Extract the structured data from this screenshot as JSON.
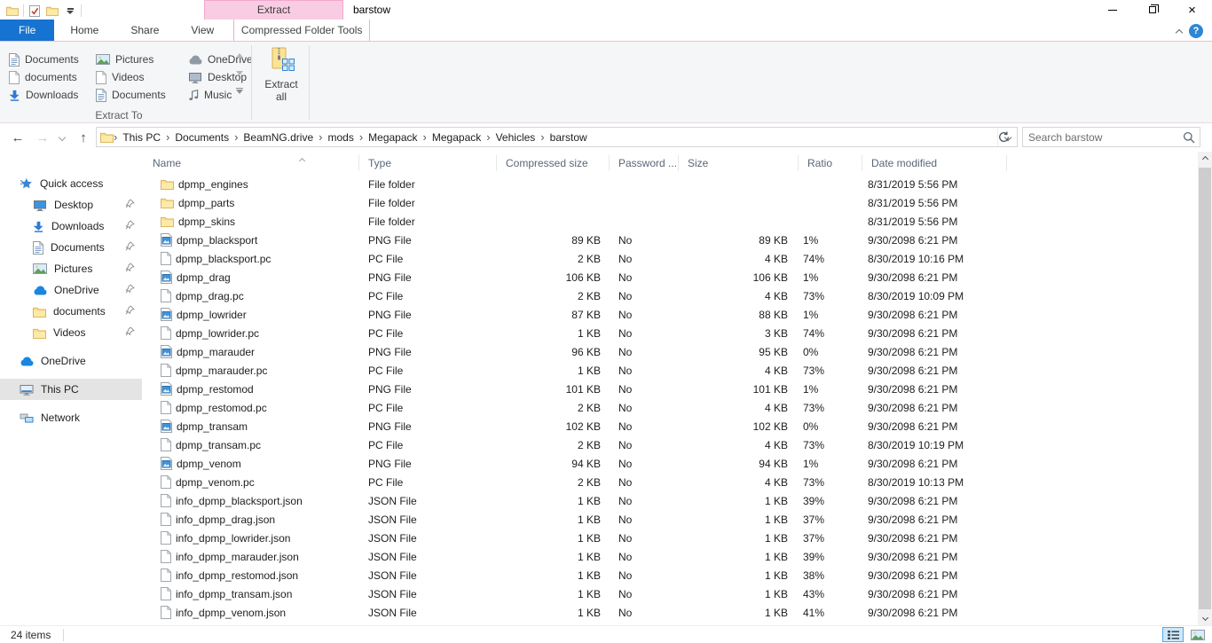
{
  "titlebar": {
    "contextual_header": "Extract",
    "window_title": "barstow",
    "qat_icons": [
      "explorer-folder-icon",
      "properties-check-icon",
      "new-folder-icon",
      "qat-customize-icon"
    ]
  },
  "tabs": [
    {
      "label": "File",
      "file": true
    },
    {
      "label": "Home"
    },
    {
      "label": "Share"
    },
    {
      "label": "View"
    },
    {
      "label": "Compressed Folder Tools",
      "contextual": true
    }
  ],
  "ribbon": {
    "group_label": "Extract To",
    "destinations": [
      {
        "label": "Documents",
        "icon": "document-icon"
      },
      {
        "label": "Pictures",
        "icon": "picture-icon"
      },
      {
        "label": "OneDrive",
        "icon": "cloud-gray-icon"
      },
      {
        "label": "documents",
        "icon": "blank-file-icon"
      },
      {
        "label": "Videos",
        "icon": "blank-file-icon"
      },
      {
        "label": "Desktop",
        "icon": "monitor-gray-icon"
      },
      {
        "label": "Downloads",
        "icon": "download-arrow-icon"
      },
      {
        "label": "Documents",
        "icon": "document-icon"
      },
      {
        "label": "Music",
        "icon": "music-note-icon"
      }
    ],
    "extract_all_label": "Extract all"
  },
  "addressbar": {
    "breadcrumbs": [
      "This PC",
      "Documents",
      "BeamNG.drive",
      "mods",
      "Megapack",
      "Megapack",
      "Vehicles",
      "barstow"
    ],
    "search_placeholder": "Search barstow"
  },
  "sidebar": {
    "sections": [
      {
        "label": "Quick access",
        "icon": "quick-access-star-icon",
        "items": [
          {
            "label": "Desktop",
            "icon": "desktop-blue-icon",
            "pinned": true
          },
          {
            "label": "Downloads",
            "icon": "download-arrow-icon",
            "pinned": true
          },
          {
            "label": "Documents",
            "icon": "document-icon",
            "pinned": true
          },
          {
            "label": "Pictures",
            "icon": "picture-icon",
            "pinned": true
          },
          {
            "label": "OneDrive",
            "icon": "cloud-blue-icon",
            "pinned": true
          },
          {
            "label": "documents",
            "icon": "folder-icon",
            "pinned": true
          },
          {
            "label": "Videos",
            "icon": "folder-icon",
            "pinned": true
          }
        ]
      },
      {
        "label": "OneDrive",
        "icon": "cloud-blue-icon",
        "items": []
      },
      {
        "label": "This PC",
        "icon": "this-pc-icon",
        "selected": true,
        "items": []
      },
      {
        "label": "Network",
        "icon": "network-icon",
        "items": []
      }
    ]
  },
  "table": {
    "columns": [
      "Name",
      "Type",
      "Compressed size",
      "Password ...",
      "Size",
      "Ratio",
      "Date modified"
    ],
    "sorted_by": "Name",
    "rows": [
      {
        "name": "dpmp_engines",
        "icon": "folder-icon",
        "type": "File folder",
        "compressed": "",
        "password": "",
        "size": "",
        "ratio": "",
        "modified": "8/31/2019 5:56 PM"
      },
      {
        "name": "dpmp_parts",
        "icon": "folder-icon",
        "type": "File folder",
        "compressed": "",
        "password": "",
        "size": "",
        "ratio": "",
        "modified": "8/31/2019 5:56 PM"
      },
      {
        "name": "dpmp_skins",
        "icon": "folder-icon",
        "type": "File folder",
        "compressed": "",
        "password": "",
        "size": "",
        "ratio": "",
        "modified": "8/31/2019 5:56 PM"
      },
      {
        "name": "dpmp_blacksport",
        "icon": "png-file-icon",
        "type": "PNG File",
        "compressed": "89 KB",
        "password": "No",
        "size": "89 KB",
        "ratio": "1%",
        "modified": "9/30/2098 6:21 PM"
      },
      {
        "name": "dpmp_blacksport.pc",
        "icon": "blank-file-icon",
        "type": "PC File",
        "compressed": "2 KB",
        "password": "No",
        "size": "4 KB",
        "ratio": "74%",
        "modified": "8/30/2019 10:16 PM"
      },
      {
        "name": "dpmp_drag",
        "icon": "png-file-icon",
        "type": "PNG File",
        "compressed": "106 KB",
        "password": "No",
        "size": "106 KB",
        "ratio": "1%",
        "modified": "9/30/2098 6:21 PM"
      },
      {
        "name": "dpmp_drag.pc",
        "icon": "blank-file-icon",
        "type": "PC File",
        "compressed": "2 KB",
        "password": "No",
        "size": "4 KB",
        "ratio": "73%",
        "modified": "8/30/2019 10:09 PM"
      },
      {
        "name": "dpmp_lowrider",
        "icon": "png-file-icon",
        "type": "PNG File",
        "compressed": "87 KB",
        "password": "No",
        "size": "88 KB",
        "ratio": "1%",
        "modified": "9/30/2098 6:21 PM"
      },
      {
        "name": "dpmp_lowrider.pc",
        "icon": "blank-file-icon",
        "type": "PC File",
        "compressed": "1 KB",
        "password": "No",
        "size": "3 KB",
        "ratio": "74%",
        "modified": "9/30/2098 6:21 PM"
      },
      {
        "name": "dpmp_marauder",
        "icon": "png-file-icon",
        "type": "PNG File",
        "compressed": "96 KB",
        "password": "No",
        "size": "95 KB",
        "ratio": "0%",
        "modified": "9/30/2098 6:21 PM"
      },
      {
        "name": "dpmp_marauder.pc",
        "icon": "blank-file-icon",
        "type": "PC File",
        "compressed": "1 KB",
        "password": "No",
        "size": "4 KB",
        "ratio": "73%",
        "modified": "9/30/2098 6:21 PM"
      },
      {
        "name": "dpmp_restomod",
        "icon": "png-file-icon",
        "type": "PNG File",
        "compressed": "101 KB",
        "password": "No",
        "size": "101 KB",
        "ratio": "1%",
        "modified": "9/30/2098 6:21 PM"
      },
      {
        "name": "dpmp_restomod.pc",
        "icon": "blank-file-icon",
        "type": "PC File",
        "compressed": "2 KB",
        "password": "No",
        "size": "4 KB",
        "ratio": "73%",
        "modified": "9/30/2098 6:21 PM"
      },
      {
        "name": "dpmp_transam",
        "icon": "png-file-icon",
        "type": "PNG File",
        "compressed": "102 KB",
        "password": "No",
        "size": "102 KB",
        "ratio": "0%",
        "modified": "9/30/2098 6:21 PM"
      },
      {
        "name": "dpmp_transam.pc",
        "icon": "blank-file-icon",
        "type": "PC File",
        "compressed": "2 KB",
        "password": "No",
        "size": "4 KB",
        "ratio": "73%",
        "modified": "8/30/2019 10:19 PM"
      },
      {
        "name": "dpmp_venom",
        "icon": "png-file-icon",
        "type": "PNG File",
        "compressed": "94 KB",
        "password": "No",
        "size": "94 KB",
        "ratio": "1%",
        "modified": "9/30/2098 6:21 PM"
      },
      {
        "name": "dpmp_venom.pc",
        "icon": "blank-file-icon",
        "type": "PC File",
        "compressed": "2 KB",
        "password": "No",
        "size": "4 KB",
        "ratio": "73%",
        "modified": "8/30/2019 10:13 PM"
      },
      {
        "name": "info_dpmp_blacksport.json",
        "icon": "blank-file-icon",
        "type": "JSON File",
        "compressed": "1 KB",
        "password": "No",
        "size": "1 KB",
        "ratio": "39%",
        "modified": "9/30/2098 6:21 PM"
      },
      {
        "name": "info_dpmp_drag.json",
        "icon": "blank-file-icon",
        "type": "JSON File",
        "compressed": "1 KB",
        "password": "No",
        "size": "1 KB",
        "ratio": "37%",
        "modified": "9/30/2098 6:21 PM"
      },
      {
        "name": "info_dpmp_lowrider.json",
        "icon": "blank-file-icon",
        "type": "JSON File",
        "compressed": "1 KB",
        "password": "No",
        "size": "1 KB",
        "ratio": "37%",
        "modified": "9/30/2098 6:21 PM"
      },
      {
        "name": "info_dpmp_marauder.json",
        "icon": "blank-file-icon",
        "type": "JSON File",
        "compressed": "1 KB",
        "password": "No",
        "size": "1 KB",
        "ratio": "39%",
        "modified": "9/30/2098 6:21 PM"
      },
      {
        "name": "info_dpmp_restomod.json",
        "icon": "blank-file-icon",
        "type": "JSON File",
        "compressed": "1 KB",
        "password": "No",
        "size": "1 KB",
        "ratio": "38%",
        "modified": "9/30/2098 6:21 PM"
      },
      {
        "name": "info_dpmp_transam.json",
        "icon": "blank-file-icon",
        "type": "JSON File",
        "compressed": "1 KB",
        "password": "No",
        "size": "1 KB",
        "ratio": "43%",
        "modified": "9/30/2098 6:21 PM"
      },
      {
        "name": "info_dpmp_venom.json",
        "icon": "blank-file-icon",
        "type": "JSON File",
        "compressed": "1 KB",
        "password": "No",
        "size": "1 KB",
        "ratio": "41%",
        "modified": "9/30/2098 6:21 PM"
      }
    ]
  },
  "statusbar": {
    "items_count": "24 items"
  },
  "colors": {
    "accent_blue": "#1673d1",
    "contextual_pink": "#f8cde4",
    "contextual_pink_border": "#f2a9ce",
    "ribbon_bg": "#f5f6f7",
    "selection_gray": "#e4e4e4",
    "folder_yellow": "#fbdf90"
  }
}
